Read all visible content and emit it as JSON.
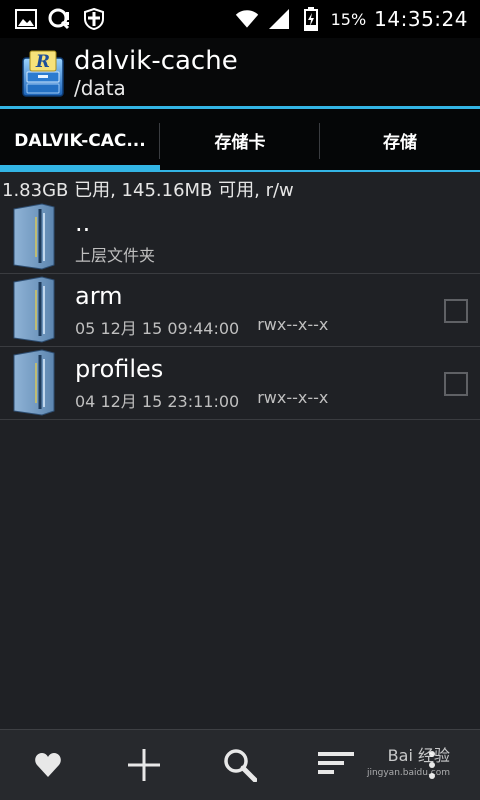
{
  "status_bar": {
    "battery_percent": "15%",
    "time": "14:35:24",
    "icons": [
      "picture-icon",
      "notification-icon",
      "shield-icon",
      "wifi-icon",
      "cellular-icon",
      "battery-charging-icon"
    ]
  },
  "header": {
    "title": "dalvik-cache",
    "subtitle": "/data"
  },
  "tabs": [
    {
      "label": "DALVIK-CAC...",
      "active": true
    },
    {
      "label": "存储卡",
      "active": false
    },
    {
      "label": "存储",
      "active": false
    }
  ],
  "storage_info": "1.83GB 已用, 145.16MB 可用, r/w",
  "files": [
    {
      "name": "..",
      "subtitle": "上层文件夹"
    },
    {
      "name": "arm",
      "date": "05 12月 15 09:44:00",
      "perms": "rwx--x--x"
    },
    {
      "name": "profiles",
      "date": "04 12月 15 23:11:00",
      "perms": "rwx--x--x"
    }
  ],
  "bottom_bar": {
    "buttons": [
      "favorites-icon",
      "add-icon",
      "search-icon",
      "sort-icon",
      "more-icon"
    ]
  },
  "watermark": {
    "text": "Bai 经验",
    "url": "jingyan.baidu.com"
  },
  "colors": {
    "accent": "#33b5e5",
    "background": "#1f2125",
    "header": "#070809"
  }
}
